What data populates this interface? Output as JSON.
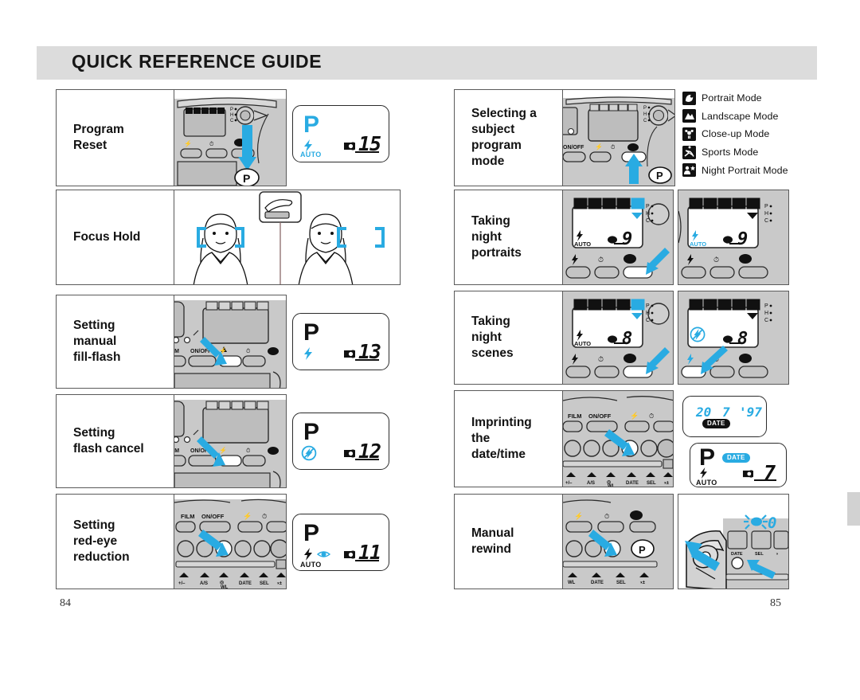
{
  "header": {
    "title": "QUICK REFERENCE GUIDE"
  },
  "page_numbers": {
    "left": "84",
    "right": "85"
  },
  "left_column": [
    {
      "id": "program-reset",
      "label": "Program\nReset",
      "label_lines": [
        "Program",
        "Reset"
      ],
      "lcd": {
        "mode": "P",
        "mode_color": "#29ABE2",
        "flash": "auto",
        "flash_color": "#29ABE2",
        "auto_text": "AUTO",
        "counter": "15"
      },
      "camera_note": "top deck with P button and blue down arrow",
      "buttons": [
        "P"
      ]
    },
    {
      "id": "focus-hold",
      "label_lines": [
        "Focus Hold"
      ],
      "illustration": "two portraits with cyan focus brackets and shutter-button inset"
    },
    {
      "id": "setting-manual-fill-flash",
      "label_lines": [
        "Setting",
        "manual",
        "fill-flash"
      ],
      "lcd": {
        "mode": "P",
        "mode_color": "#111111",
        "flash": "fill",
        "flash_color": "#29ABE2",
        "auto_text": "",
        "counter": "13"
      },
      "camera_buttons": [
        "LM",
        "ON/OFF"
      ]
    },
    {
      "id": "setting-flash-cancel",
      "label_lines": [
        "Setting",
        "flash cancel"
      ],
      "lcd": {
        "mode": "P",
        "mode_color": "#111111",
        "flash": "cancel",
        "flash_color": "#29ABE2",
        "auto_text": "",
        "counter": "12"
      },
      "camera_buttons": [
        "LM",
        "ON/OFF"
      ]
    },
    {
      "id": "setting-red-eye-reduction",
      "label_lines": [
        "Setting",
        "red-eye",
        "reduction"
      ],
      "lcd": {
        "mode": "P",
        "mode_color": "#111111",
        "flash": "auto",
        "flash_color": "#111111",
        "eye": true,
        "auto_text": "AUTO",
        "counter": "11"
      },
      "camera_buttons": [
        "FILM",
        "ON/OFF"
      ],
      "camera_dial_labels": [
        "+/–",
        "A/S",
        "WL",
        "DATE",
        "SEL"
      ]
    }
  ],
  "right_column": [
    {
      "id": "selecting-subject-program-mode",
      "label_lines": [
        "Selecting a",
        "subject",
        "program",
        "mode"
      ],
      "camera_note": "top deck, mode button with blue up arrow, P button",
      "dial_labels": [
        "P",
        "H",
        "C"
      ]
    },
    {
      "id": "taking-night-portraits",
      "label_lines": [
        "Taking",
        "night",
        "portraits"
      ],
      "panel_before": {
        "selected_mode_index": 4,
        "counter": "9",
        "flash": "auto",
        "auto_text": "AUTO"
      },
      "panel_after": {
        "selected_mode_index": -1,
        "counter": "9",
        "flash": "auto",
        "auto_text": "AUTO",
        "flash_color": "#29ABE2"
      },
      "dial_labels": [
        "P",
        "H",
        "C"
      ]
    },
    {
      "id": "taking-night-scenes",
      "label_lines": [
        "Taking",
        "night",
        "scenes"
      ],
      "panel_before": {
        "selected_mode_index": 4,
        "counter": "8",
        "flash": "auto",
        "auto_text": "AUTO"
      },
      "panel_after": {
        "selected_mode_index": -1,
        "counter": "8",
        "flash": "cancel",
        "auto_text": ""
      },
      "dial_labels": [
        "P",
        "H",
        "C"
      ]
    },
    {
      "id": "imprinting-the-date-time",
      "label_lines": [
        "Imprinting",
        "the",
        "date/time"
      ],
      "camera_buttons": [
        "FILM",
        "ON/OFF"
      ],
      "camera_dial_labels": [
        "+/–",
        "A/S",
        "WL",
        "DATE",
        "SEL"
      ],
      "date_readout": {
        "day": "20",
        "month": "7",
        "year": "'97",
        "badge": "DATE"
      },
      "lcd": {
        "mode": "P",
        "badge": "DATE",
        "flash": "auto",
        "auto_text": "AUTO",
        "counter": "7"
      }
    },
    {
      "id": "manual-rewind",
      "label_lines": [
        "Manual",
        "rewind"
      ],
      "illustration": "film cartridge removal with blinking 0 counter",
      "counter": "0"
    }
  ],
  "legend": {
    "items": [
      {
        "icon": "portrait-mode-icon",
        "label": "Portrait Mode"
      },
      {
        "icon": "landscape-mode-icon",
        "label": "Landscape Mode"
      },
      {
        "icon": "close-up-mode-icon",
        "label": "Close-up Mode"
      },
      {
        "icon": "sports-mode-icon",
        "label": "Sports Mode"
      },
      {
        "icon": "night-portrait-mode-icon",
        "label": "Night Portrait Mode"
      }
    ]
  },
  "colors": {
    "accent": "#29ABE2",
    "header_band": "#dcdcdc",
    "camera_body": "#c9c9c9",
    "outline": "#5a5a5a"
  }
}
